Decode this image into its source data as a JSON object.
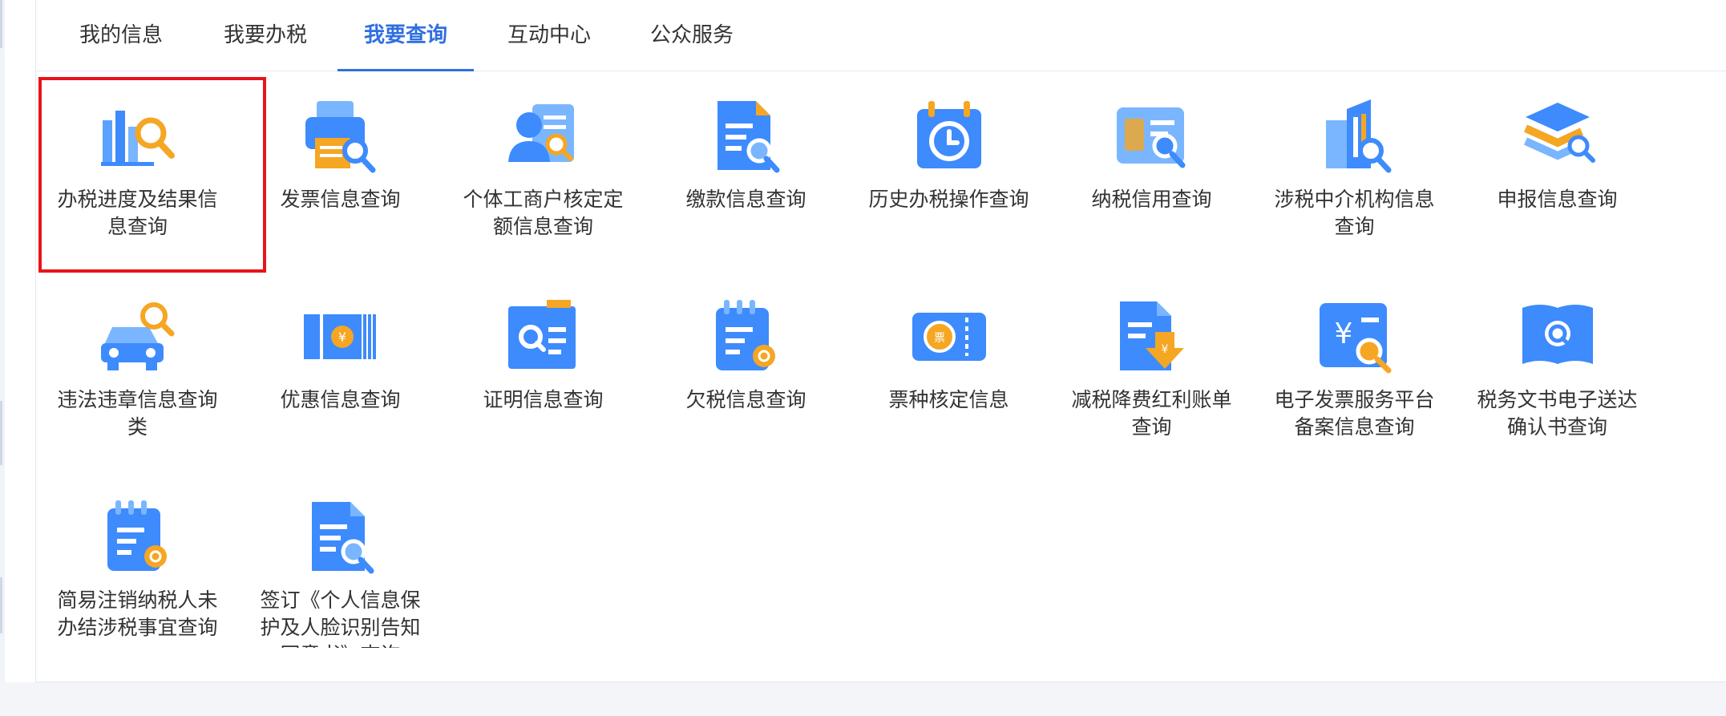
{
  "tabs": [
    {
      "label": "我的信息",
      "active": false
    },
    {
      "label": "我要办税",
      "active": false
    },
    {
      "label": "我要查询",
      "active": true
    },
    {
      "label": "互动中心",
      "active": false
    },
    {
      "label": "公众服务",
      "active": false
    }
  ],
  "items": [
    {
      "label": "办税进度及结果信\n息查询",
      "icon": "bar-chart-search-icon"
    },
    {
      "label": "发票信息查询",
      "icon": "printer-search-icon"
    },
    {
      "label": "个体工商户核定定\n额信息查询",
      "icon": "user-card-search-icon"
    },
    {
      "label": "缴款信息查询",
      "icon": "document-search-icon"
    },
    {
      "label": "历史办税操作查询",
      "icon": "calendar-history-icon"
    },
    {
      "label": "纳税信用查询",
      "icon": "credit-card-search-icon"
    },
    {
      "label": "涉税中介机构信息\n查询",
      "icon": "building-search-icon"
    },
    {
      "label": "申报信息查询",
      "icon": "layers-search-icon"
    },
    {
      "label": "违法违章信息查询\n类",
      "icon": "car-search-icon"
    },
    {
      "label": "优惠信息查询",
      "icon": "ticket-yuan-icon"
    },
    {
      "label": "证明信息查询",
      "icon": "certificate-search-icon"
    },
    {
      "label": "欠税信息查询",
      "icon": "notepad-search-icon"
    },
    {
      "label": "票种核定信息",
      "icon": "ticket-type-icon"
    },
    {
      "label": "减税降费红利账单\n查询",
      "icon": "document-arrow-down-icon"
    },
    {
      "label": "电子发票服务平台\n备案信息查询",
      "icon": "yuan-card-search-icon"
    },
    {
      "label": "税务文书电子送达\n确认书查询",
      "icon": "book-search-icon"
    },
    {
      "label": "简易注销纳税人未\n办结涉税事宜查询",
      "icon": "notepad-search-icon"
    },
    {
      "label": "签订《个人信息保\n护及人脸识别告知\n同意书》查询",
      "icon": "document-search-icon"
    }
  ],
  "colors": {
    "accent": "#2f6fe0",
    "highlight": "#e8141a",
    "icon_blue": "#3d8bfd",
    "icon_orange": "#f5a623"
  }
}
